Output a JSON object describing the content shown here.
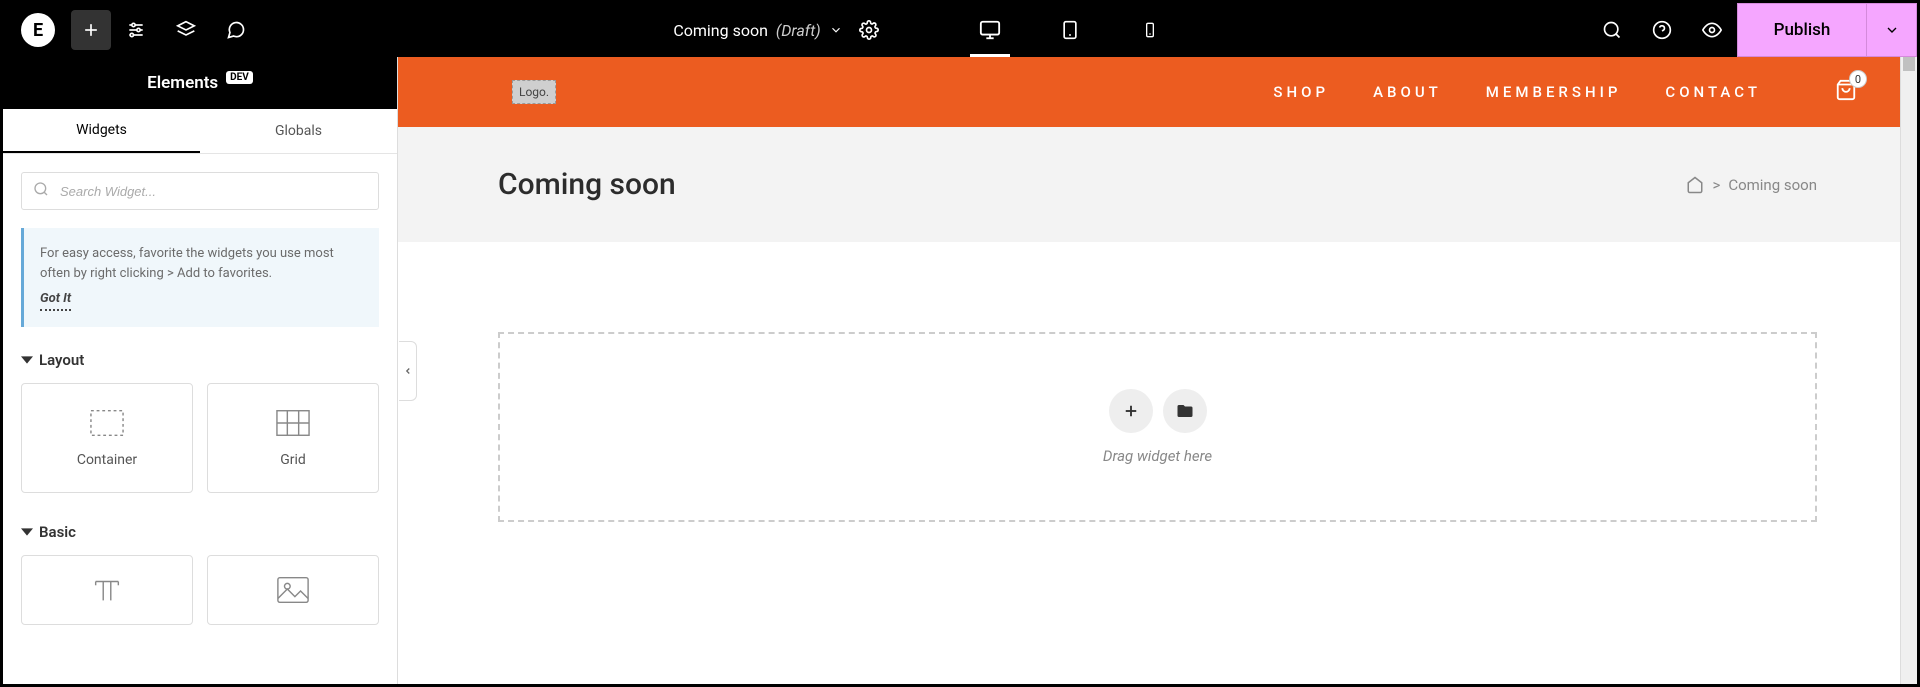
{
  "topbar": {
    "doc_title": "Coming soon",
    "draft_label": "(Draft)",
    "publish_label": "Publish"
  },
  "panel": {
    "title": "Elements",
    "badge": "DEV",
    "tabs": {
      "widgets": "Widgets",
      "globals": "Globals"
    },
    "search_placeholder": "Search Widget...",
    "tip": {
      "text": "For easy access, favorite the widgets you use most often by right clicking > Add to favorites.",
      "gotit": "Got It"
    },
    "sections": {
      "layout": {
        "title": "Layout",
        "items": [
          {
            "label": "Container"
          },
          {
            "label": "Grid"
          }
        ]
      },
      "basic": {
        "title": "Basic"
      }
    }
  },
  "site": {
    "logo_placeholder": "Logo.",
    "nav": [
      "SHOP",
      "ABOUT",
      "MEMBERSHIP",
      "CONTACT"
    ],
    "cart_count": "0"
  },
  "page": {
    "title": "Coming soon",
    "breadcrumb_sep": ">",
    "breadcrumb_current": "Coming soon"
  },
  "dropzone": {
    "hint": "Drag widget here"
  }
}
